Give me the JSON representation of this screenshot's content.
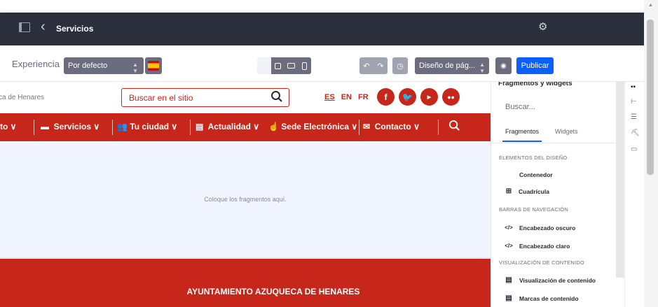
{
  "topbar": {
    "title": "Servicios"
  },
  "toolbar": {
    "experience_label": "Experiencia",
    "experience_value": "Por defecto",
    "layout_select": "Diseño de pág...",
    "publish": "Publicar"
  },
  "site": {
    "name_fragment": "ca de Henares",
    "search_placeholder": "Buscar en el sitio",
    "languages": [
      "ES",
      "EN",
      "FR"
    ],
    "social": [
      "f",
      "t",
      "You",
      "fl"
    ],
    "nav": [
      "to",
      "Servicios",
      "Tu ciudad",
      "Actualidad",
      "Sede Electrónica",
      "Contacto"
    ],
    "dropzone_message": "Coloque los fragmentos aquí.",
    "footer_title": "AYUNTAMIENTO AZUQUECA DE HENARES"
  },
  "panel": {
    "title": "Fragmentos y widgets",
    "search_placeholder": "Buscar...",
    "tabs": [
      "Fragmentos",
      "Widgets"
    ],
    "sections": [
      {
        "title": "ELEMENTOS DEL DISEÑO",
        "items": [
          {
            "label": "Contenedor",
            "icon": "none"
          },
          {
            "label": "Cuadrícula",
            "icon": "grid-icon"
          }
        ]
      },
      {
        "title": "BARRAS DE NAVEGACIÓN",
        "items": [
          {
            "label": "Encabezado oscuro",
            "icon": "code-icon"
          },
          {
            "label": "Encabezado claro",
            "icon": "code-icon"
          }
        ]
      },
      {
        "title": "VISUALIZACIÓN DE CONTENIDO",
        "items": [
          {
            "label": "Visualización de contenido",
            "icon": "content-icon"
          },
          {
            "label": "Marcas de contenido",
            "icon": "content-icon"
          }
        ]
      }
    ]
  },
  "colors": {
    "brand_red": "#c7261b",
    "topbar": "#2b2f3b",
    "accent_blue": "#0b5fff"
  }
}
